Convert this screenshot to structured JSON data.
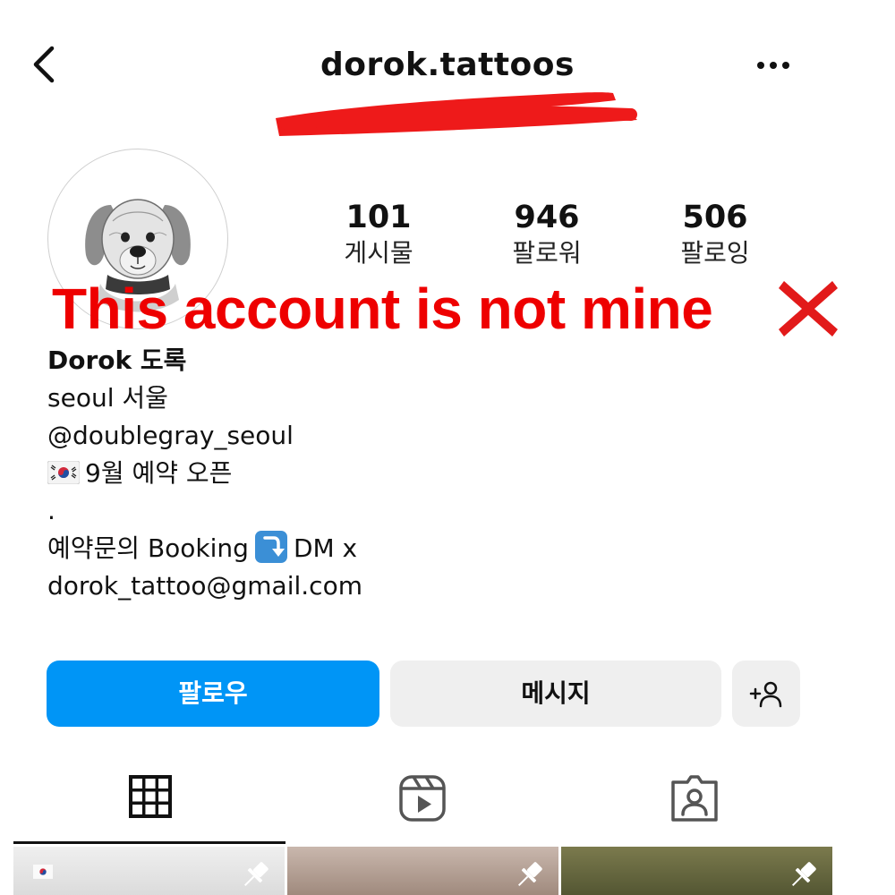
{
  "header": {
    "username": "dorok.tattoos"
  },
  "stats": {
    "posts": {
      "value": "101",
      "label": "게시물"
    },
    "followers": {
      "value": "946",
      "label": "팔로워"
    },
    "following": {
      "value": "506",
      "label": "팔로잉"
    }
  },
  "overlay": {
    "text": "This account is not mine",
    "color": "#ee0000"
  },
  "bio": {
    "name": "Dorok 도록",
    "line1": "seoul 서울",
    "line2": "@doublegray_seoul",
    "line3": "9월 예약 오픈",
    "line4": ".",
    "line5_pre": "예약문의 Booking",
    "line5_post": "DM x",
    "line6": "dorok_tattoo@gmail.com"
  },
  "actions": {
    "follow_label": "팔로우",
    "message_label": "메시지",
    "follow_color": "#0095f6"
  },
  "icons": {
    "back": "chevron-left-icon",
    "more": "more-horizontal-icon",
    "suggest": "add-person-icon",
    "grid": "grid-icon",
    "reels": "reels-icon",
    "tagged": "tagged-icon",
    "pin": "pin-icon",
    "flag": "korea-flag-icon",
    "arrow": "arrow-down-emoji-icon"
  }
}
